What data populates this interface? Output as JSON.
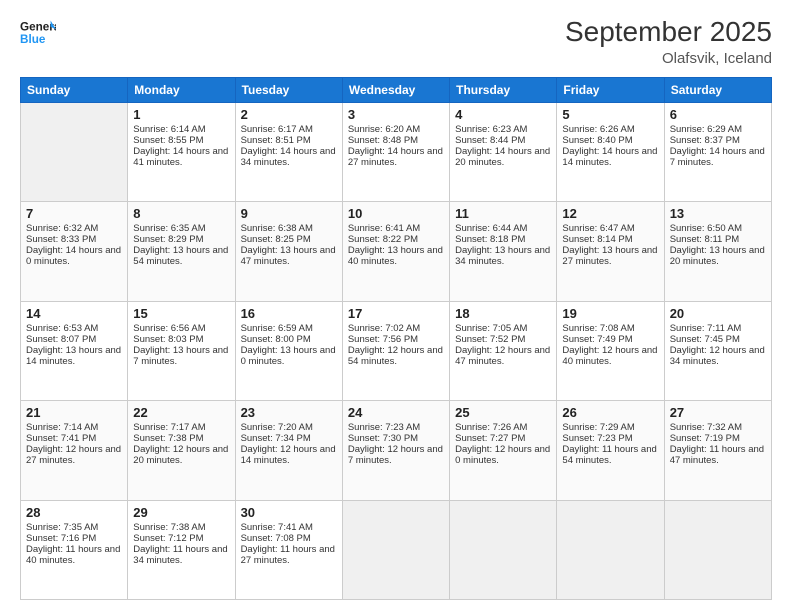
{
  "header": {
    "logo_text_general": "General",
    "logo_text_blue": "Blue",
    "month_title": "September 2025",
    "location": "Olafsvik, Iceland"
  },
  "weekdays": [
    "Sunday",
    "Monday",
    "Tuesday",
    "Wednesday",
    "Thursday",
    "Friday",
    "Saturday"
  ],
  "weeks": [
    [
      {
        "day": "",
        "empty": true
      },
      {
        "day": "1",
        "sunrise": "Sunrise: 6:14 AM",
        "sunset": "Sunset: 8:55 PM",
        "daylight": "Daylight: 14 hours and 41 minutes."
      },
      {
        "day": "2",
        "sunrise": "Sunrise: 6:17 AM",
        "sunset": "Sunset: 8:51 PM",
        "daylight": "Daylight: 14 hours and 34 minutes."
      },
      {
        "day": "3",
        "sunrise": "Sunrise: 6:20 AM",
        "sunset": "Sunset: 8:48 PM",
        "daylight": "Daylight: 14 hours and 27 minutes."
      },
      {
        "day": "4",
        "sunrise": "Sunrise: 6:23 AM",
        "sunset": "Sunset: 8:44 PM",
        "daylight": "Daylight: 14 hours and 20 minutes."
      },
      {
        "day": "5",
        "sunrise": "Sunrise: 6:26 AM",
        "sunset": "Sunset: 8:40 PM",
        "daylight": "Daylight: 14 hours and 14 minutes."
      },
      {
        "day": "6",
        "sunrise": "Sunrise: 6:29 AM",
        "sunset": "Sunset: 8:37 PM",
        "daylight": "Daylight: 14 hours and 7 minutes."
      }
    ],
    [
      {
        "day": "7",
        "sunrise": "Sunrise: 6:32 AM",
        "sunset": "Sunset: 8:33 PM",
        "daylight": "Daylight: 14 hours and 0 minutes."
      },
      {
        "day": "8",
        "sunrise": "Sunrise: 6:35 AM",
        "sunset": "Sunset: 8:29 PM",
        "daylight": "Daylight: 13 hours and 54 minutes."
      },
      {
        "day": "9",
        "sunrise": "Sunrise: 6:38 AM",
        "sunset": "Sunset: 8:25 PM",
        "daylight": "Daylight: 13 hours and 47 minutes."
      },
      {
        "day": "10",
        "sunrise": "Sunrise: 6:41 AM",
        "sunset": "Sunset: 8:22 PM",
        "daylight": "Daylight: 13 hours and 40 minutes."
      },
      {
        "day": "11",
        "sunrise": "Sunrise: 6:44 AM",
        "sunset": "Sunset: 8:18 PM",
        "daylight": "Daylight: 13 hours and 34 minutes."
      },
      {
        "day": "12",
        "sunrise": "Sunrise: 6:47 AM",
        "sunset": "Sunset: 8:14 PM",
        "daylight": "Daylight: 13 hours and 27 minutes."
      },
      {
        "day": "13",
        "sunrise": "Sunrise: 6:50 AM",
        "sunset": "Sunset: 8:11 PM",
        "daylight": "Daylight: 13 hours and 20 minutes."
      }
    ],
    [
      {
        "day": "14",
        "sunrise": "Sunrise: 6:53 AM",
        "sunset": "Sunset: 8:07 PM",
        "daylight": "Daylight: 13 hours and 14 minutes."
      },
      {
        "day": "15",
        "sunrise": "Sunrise: 6:56 AM",
        "sunset": "Sunset: 8:03 PM",
        "daylight": "Daylight: 13 hours and 7 minutes."
      },
      {
        "day": "16",
        "sunrise": "Sunrise: 6:59 AM",
        "sunset": "Sunset: 8:00 PM",
        "daylight": "Daylight: 13 hours and 0 minutes."
      },
      {
        "day": "17",
        "sunrise": "Sunrise: 7:02 AM",
        "sunset": "Sunset: 7:56 PM",
        "daylight": "Daylight: 12 hours and 54 minutes."
      },
      {
        "day": "18",
        "sunrise": "Sunrise: 7:05 AM",
        "sunset": "Sunset: 7:52 PM",
        "daylight": "Daylight: 12 hours and 47 minutes."
      },
      {
        "day": "19",
        "sunrise": "Sunrise: 7:08 AM",
        "sunset": "Sunset: 7:49 PM",
        "daylight": "Daylight: 12 hours and 40 minutes."
      },
      {
        "day": "20",
        "sunrise": "Sunrise: 7:11 AM",
        "sunset": "Sunset: 7:45 PM",
        "daylight": "Daylight: 12 hours and 34 minutes."
      }
    ],
    [
      {
        "day": "21",
        "sunrise": "Sunrise: 7:14 AM",
        "sunset": "Sunset: 7:41 PM",
        "daylight": "Daylight: 12 hours and 27 minutes."
      },
      {
        "day": "22",
        "sunrise": "Sunrise: 7:17 AM",
        "sunset": "Sunset: 7:38 PM",
        "daylight": "Daylight: 12 hours and 20 minutes."
      },
      {
        "day": "23",
        "sunrise": "Sunrise: 7:20 AM",
        "sunset": "Sunset: 7:34 PM",
        "daylight": "Daylight: 12 hours and 14 minutes."
      },
      {
        "day": "24",
        "sunrise": "Sunrise: 7:23 AM",
        "sunset": "Sunset: 7:30 PM",
        "daylight": "Daylight: 12 hours and 7 minutes."
      },
      {
        "day": "25",
        "sunrise": "Sunrise: 7:26 AM",
        "sunset": "Sunset: 7:27 PM",
        "daylight": "Daylight: 12 hours and 0 minutes."
      },
      {
        "day": "26",
        "sunrise": "Sunrise: 7:29 AM",
        "sunset": "Sunset: 7:23 PM",
        "daylight": "Daylight: 11 hours and 54 minutes."
      },
      {
        "day": "27",
        "sunrise": "Sunrise: 7:32 AM",
        "sunset": "Sunset: 7:19 PM",
        "daylight": "Daylight: 11 hours and 47 minutes."
      }
    ],
    [
      {
        "day": "28",
        "sunrise": "Sunrise: 7:35 AM",
        "sunset": "Sunset: 7:16 PM",
        "daylight": "Daylight: 11 hours and 40 minutes."
      },
      {
        "day": "29",
        "sunrise": "Sunrise: 7:38 AM",
        "sunset": "Sunset: 7:12 PM",
        "daylight": "Daylight: 11 hours and 34 minutes."
      },
      {
        "day": "30",
        "sunrise": "Sunrise: 7:41 AM",
        "sunset": "Sunset: 7:08 PM",
        "daylight": "Daylight: 11 hours and 27 minutes."
      },
      {
        "day": "",
        "empty": true
      },
      {
        "day": "",
        "empty": true
      },
      {
        "day": "",
        "empty": true
      },
      {
        "day": "",
        "empty": true
      }
    ]
  ]
}
